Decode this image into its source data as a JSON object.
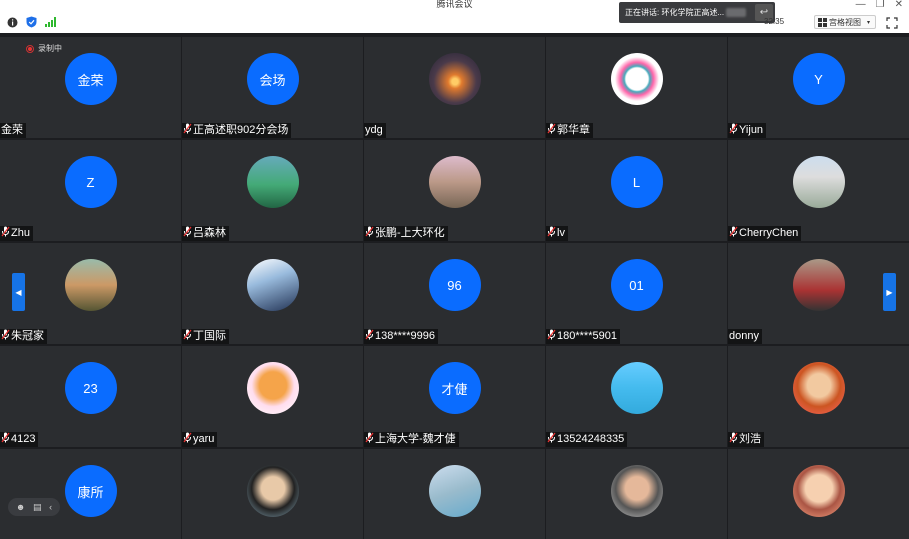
{
  "window": {
    "title": "腾讯会议",
    "speaker_notice": "正在讲话: 环化学院正高述...",
    "timer": "32:35",
    "view_label": "宫格视图",
    "recording_label": "录制中"
  },
  "participants": [
    {
      "name": "金荣",
      "avatar": "金荣",
      "mic": false
    },
    {
      "name": "正高述职902分会场",
      "avatar": "会场",
      "mic": true
    },
    {
      "name": "ydg",
      "avatar": "",
      "mic": false
    },
    {
      "name": "郭华章",
      "avatar": "",
      "mic": true
    },
    {
      "name": "Yijun",
      "avatar": "Y",
      "mic": true
    },
    {
      "name": "Zhu",
      "avatar": "Z",
      "mic": true
    },
    {
      "name": "吕森林",
      "avatar": "",
      "mic": true
    },
    {
      "name": "张鹏-上大环化",
      "avatar": "",
      "mic": true
    },
    {
      "name": "lv",
      "avatar": "L",
      "mic": true
    },
    {
      "name": "CherryChen",
      "avatar": "",
      "mic": true
    },
    {
      "name": "朱冠家",
      "avatar": "",
      "mic": true
    },
    {
      "name": "丁国际",
      "avatar": "",
      "mic": true
    },
    {
      "name": "138****9996",
      "avatar": "96",
      "mic": true
    },
    {
      "name": "180****5901",
      "avatar": "01",
      "mic": true
    },
    {
      "name": "donny",
      "avatar": "",
      "mic": false
    },
    {
      "name": "4123",
      "avatar": "23",
      "mic": true
    },
    {
      "name": "yaru",
      "avatar": "",
      "mic": true
    },
    {
      "name": "上海大学-魏才倢",
      "avatar": "才倢",
      "mic": true
    },
    {
      "name": "13524248335",
      "avatar": "",
      "mic": true
    },
    {
      "name": "刘浩",
      "avatar": "",
      "mic": true
    },
    {
      "name": "",
      "avatar": "康所",
      "mic": true
    },
    {
      "name": "",
      "avatar": "",
      "mic": true
    },
    {
      "name": "",
      "avatar": "",
      "mic": true
    },
    {
      "name": "",
      "avatar": "",
      "mic": true
    },
    {
      "name": "",
      "avatar": "",
      "mic": true
    }
  ],
  "colors": {
    "accent": "#0a6cff",
    "tile": "#2b2d30",
    "background": "#1c1d20"
  }
}
